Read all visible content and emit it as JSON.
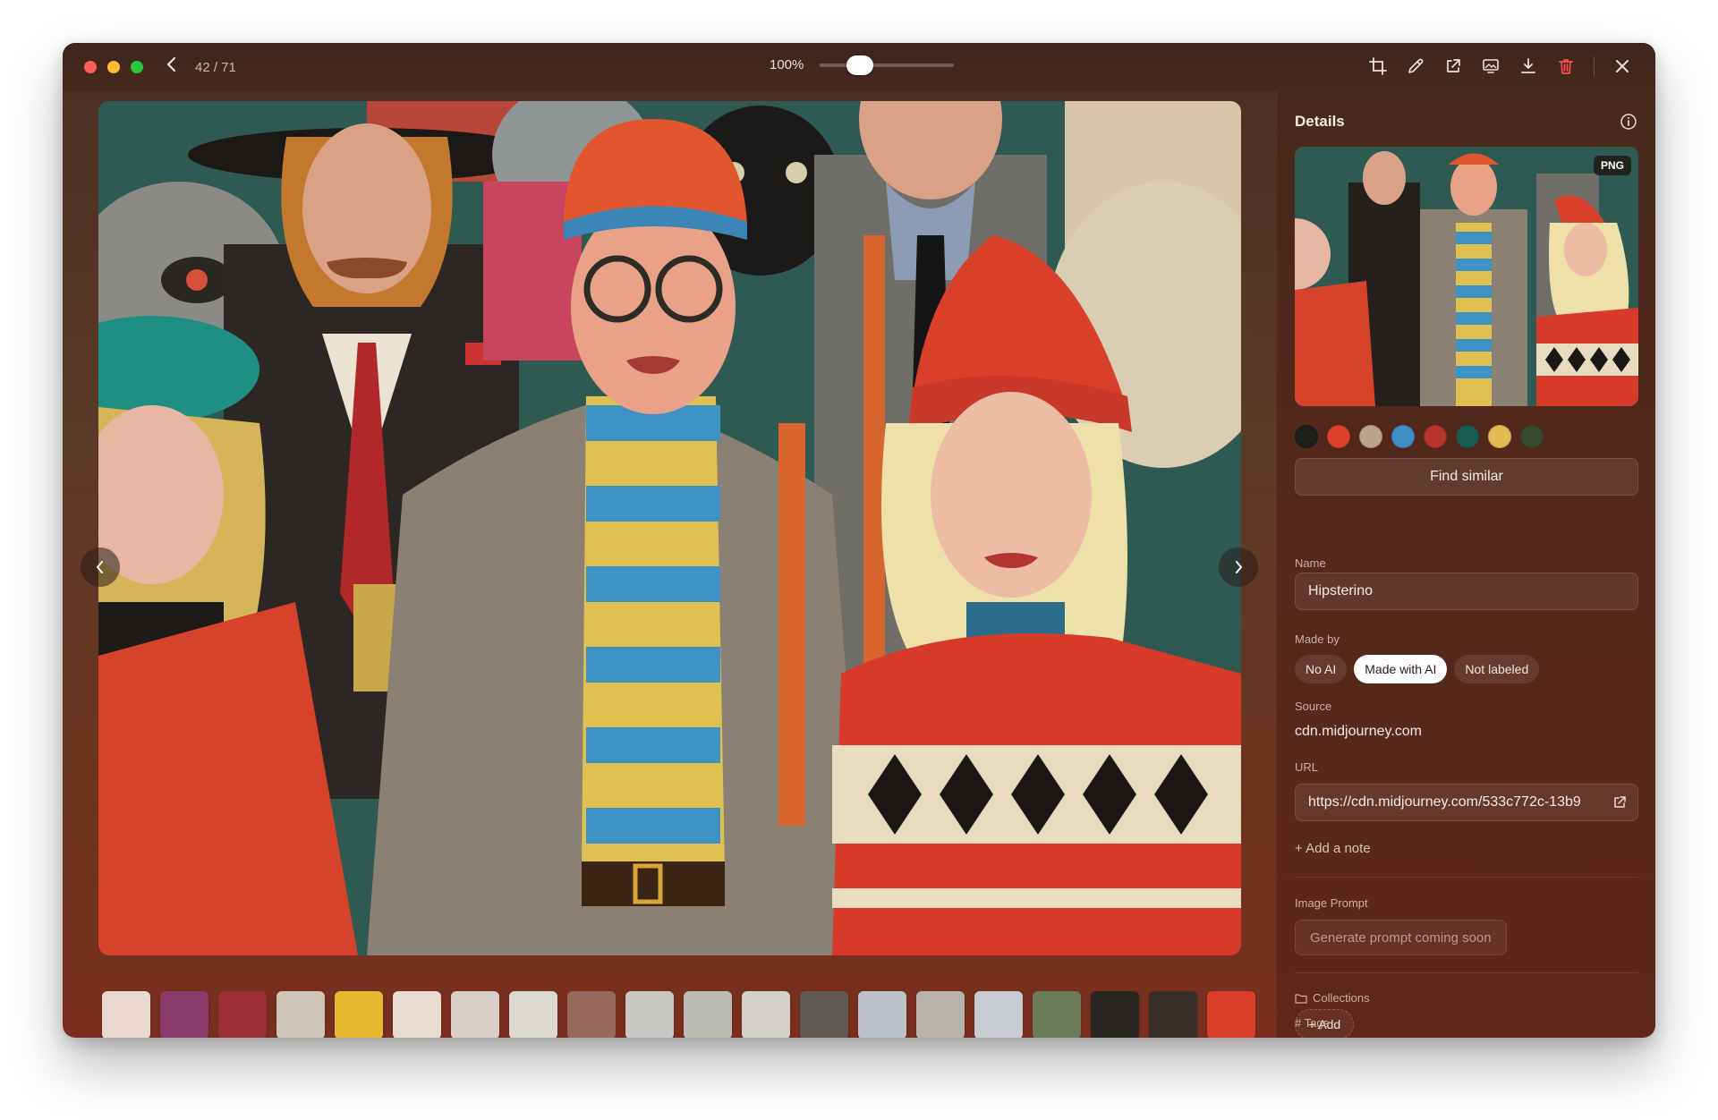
{
  "app": {
    "counter": "42 / 71",
    "zoom_label": "100%",
    "zoom_level_percent": 100
  },
  "toolbar": {
    "tools": [
      "crop-icon",
      "eyedropper-icon",
      "open-external-icon",
      "set-wallpaper-icon",
      "download-icon",
      "trash-icon",
      "close-icon"
    ],
    "trash_color": "#ff4d4d"
  },
  "viewer": {
    "filmstrip_thumbnail_count": 20
  },
  "details": {
    "title": "Details",
    "preview_badge": "PNG",
    "palette": [
      "#1e1e1a",
      "#d9412a",
      "#b8a48c",
      "#3f8fc4",
      "#b7352a",
      "#1f5a4e",
      "#e2bb55",
      "#3a4a30"
    ],
    "find_similar": "Find similar",
    "name_label": "Name",
    "name_value": "Hipsterino",
    "made_by_label": "Made by",
    "made_by_options": [
      "No AI",
      "Made with AI",
      "Not labeled"
    ],
    "made_by_selected": "Made with AI",
    "source_label": "Source",
    "source_value": "cdn.midjourney.com",
    "url_label": "URL",
    "url_value": "https://cdn.midjourney.com/533c772c-13b9",
    "add_note": "+ Add a note",
    "image_prompt_label": "Image Prompt",
    "generate_prompt": "Generate prompt coming soon",
    "collections_label": "Collections",
    "add_collection": "+ Add",
    "tags_label": "# Tags"
  }
}
